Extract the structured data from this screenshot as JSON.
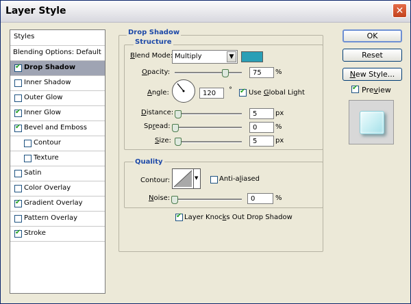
{
  "window": {
    "title": "Layer Style"
  },
  "left_panel": {
    "header": "Styles",
    "blending": "Blending Options: Default",
    "items": [
      {
        "label": "Drop Shadow",
        "checked": true,
        "selected": true
      },
      {
        "label": "Inner Shadow",
        "checked": false
      },
      {
        "label": "Outer Glow",
        "checked": false
      },
      {
        "label": "Inner Glow",
        "checked": true
      },
      {
        "label": "Bevel and Emboss",
        "checked": true
      },
      {
        "label": "Contour",
        "checked": false,
        "indent": true
      },
      {
        "label": "Texture",
        "checked": false,
        "indent": true
      },
      {
        "label": "Satin",
        "checked": false
      },
      {
        "label": "Color Overlay",
        "checked": false
      },
      {
        "label": "Gradient Overlay",
        "checked": true
      },
      {
        "label": "Pattern Overlay",
        "checked": false
      },
      {
        "label": "Stroke",
        "checked": true
      }
    ]
  },
  "drop_shadow": {
    "title": "Drop Shadow",
    "structure": {
      "title": "Structure",
      "blend_mode_label": "Blend Mode:",
      "blend_mode_value": "Multiply",
      "shadow_color": "#2a9fb6",
      "opacity_label": "Opacity:",
      "opacity_value": "75",
      "opacity_unit": "%",
      "angle_label": "Angle:",
      "angle_value": "120",
      "angle_unit": "°",
      "global_light_label": "Use Global Light",
      "global_light_checked": true,
      "distance_label": "Distance:",
      "distance_value": "5",
      "distance_unit": "px",
      "spread_label": "Spread:",
      "spread_value": "0",
      "spread_unit": "%",
      "size_label": "Size:",
      "size_value": "5",
      "size_unit": "px"
    },
    "quality": {
      "title": "Quality",
      "contour_label": "Contour:",
      "anti_aliased_label": "Anti-aliased",
      "anti_aliased_checked": false,
      "noise_label": "Noise:",
      "noise_value": "0",
      "noise_unit": "%"
    },
    "knockout_label": "Layer Knocks Out Drop Shadow",
    "knockout_checked": true
  },
  "buttons": {
    "ok": "OK",
    "reset": "Reset",
    "new_style": "New Style..."
  },
  "preview": {
    "label": "Preview",
    "checked": true
  }
}
